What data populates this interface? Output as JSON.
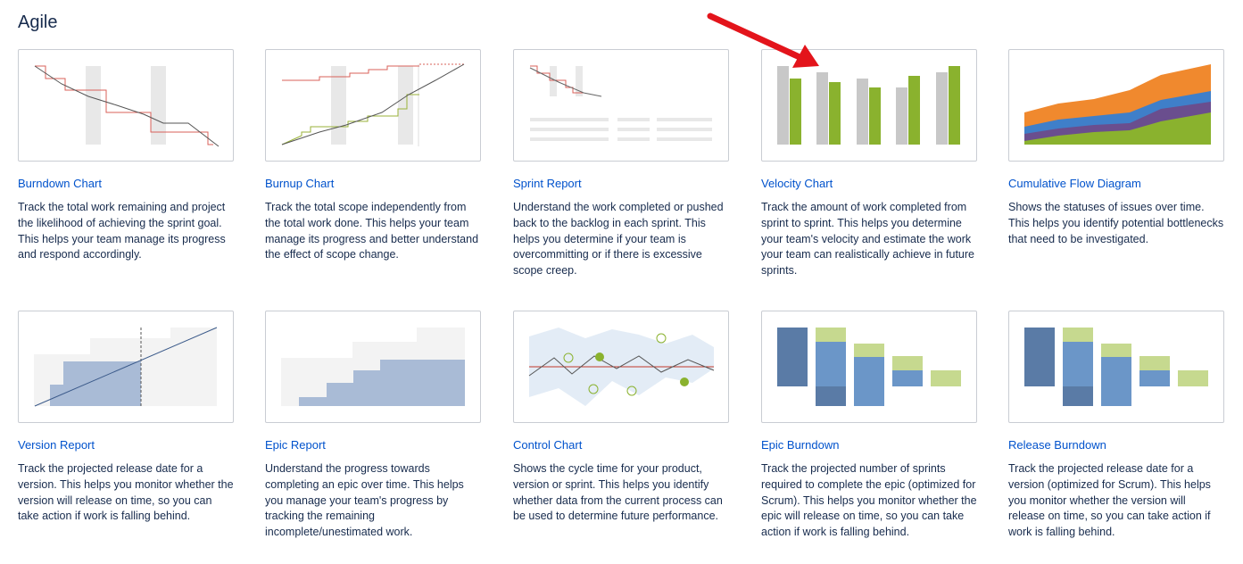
{
  "section": {
    "title": "Agile"
  },
  "reports": [
    {
      "title": "Burndown Chart",
      "icon": "burndown-chart-thumbnail",
      "description": "Track the total work remaining and project the likelihood of achieving the sprint goal. This helps your team manage its progress and respond accordingly."
    },
    {
      "title": "Burnup Chart",
      "icon": "burnup-chart-thumbnail",
      "description": "Track the total scope independently from the total work done. This helps your team manage its progress and better understand the effect of scope change."
    },
    {
      "title": "Sprint Report",
      "icon": "sprint-report-thumbnail",
      "description": "Understand the work completed or pushed back to the backlog in each sprint. This helps you determine if your team is overcommitting or if there is excessive scope creep."
    },
    {
      "title": "Velocity Chart",
      "icon": "velocity-chart-thumbnail",
      "description": "Track the amount of work completed from sprint to sprint. This helps you determine your team's velocity and estimate the work your team can realistically achieve in future sprints."
    },
    {
      "title": "Cumulative Flow Diagram",
      "icon": "cumulative-flow-thumbnail",
      "description": "Shows the statuses of issues over time. This helps you identify potential bottlenecks that need to be investigated."
    },
    {
      "title": "Version Report",
      "icon": "version-report-thumbnail",
      "description": "Track the projected release date for a version. This helps you monitor whether the version will release on time, so you can take action if work is falling behind."
    },
    {
      "title": "Epic Report",
      "icon": "epic-report-thumbnail",
      "description": "Understand the progress towards completing an epic over time. This helps you manage your team's progress by tracking the remaining incomplete/unestimated work."
    },
    {
      "title": "Control Chart",
      "icon": "control-chart-thumbnail",
      "description": "Shows the cycle time for your product, version or sprint. This helps you identify whether data from the current process can be used to determine future performance."
    },
    {
      "title": "Epic Burndown",
      "icon": "epic-burndown-thumbnail",
      "description": "Track the projected number of sprints required to complete the epic (optimized for Scrum). This helps you monitor whether the epic will release on time, so you can take action if work is falling behind."
    },
    {
      "title": "Release Burndown",
      "icon": "release-burndown-thumbnail",
      "description": "Track the projected release date for a version (optimized for Scrum). This helps you monitor whether the version will release on time, so you can take action if work is falling behind."
    }
  ],
  "colors": {
    "link": "#0052cc",
    "arrow": "#e3141b",
    "green": "#8ab22e",
    "blue": "#5a7ba6",
    "orange": "#f0892e"
  },
  "annotation": {
    "icon": "red-arrow-icon",
    "points_to": "Velocity Chart"
  }
}
